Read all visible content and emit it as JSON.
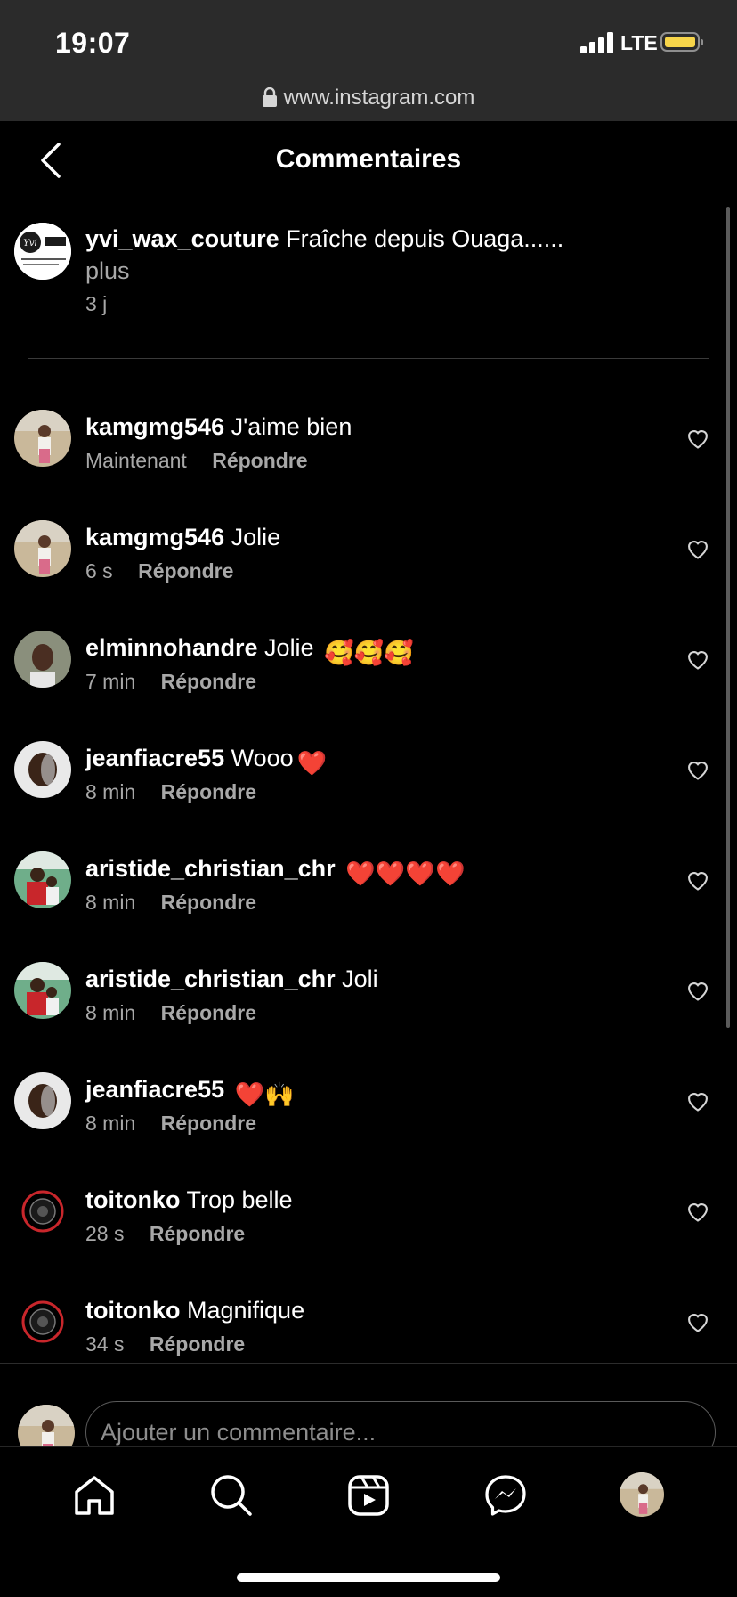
{
  "status": {
    "time": "19:07",
    "network": "LTE"
  },
  "browser": {
    "url": "www.instagram.com"
  },
  "header": {
    "title": "Commentaires"
  },
  "caption": {
    "username": "yvi_wax_couture",
    "text": "Fraîche depuis Ouaga......",
    "more": "plus",
    "time": "3 j"
  },
  "comments": [
    {
      "username": "kamgmg546",
      "text": "J'aime bien",
      "time": "Maintenant",
      "reply": "Répondre"
    },
    {
      "username": "kamgmg546",
      "text": "Jolie",
      "time": "6 s",
      "reply": "Répondre"
    },
    {
      "username": "elminnohandre",
      "text": "Jolie",
      "emoji": "🥰🥰🥰",
      "time": "7 min",
      "reply": "Répondre"
    },
    {
      "username": "jeanfiacre55",
      "text": "Wooo",
      "emoji": "❤️",
      "time": "8 min",
      "reply": "Répondre"
    },
    {
      "username": "aristide_christian_chr",
      "text": "",
      "emoji": "❤️❤️❤️❤️",
      "time": "8 min",
      "reply": "Répondre"
    },
    {
      "username": "aristide_christian_chr",
      "text": "Joli",
      "time": "8 min",
      "reply": "Répondre"
    },
    {
      "username": "jeanfiacre55",
      "text": "",
      "emoji": "❤️🙌",
      "time": "8 min",
      "reply": "Répondre"
    },
    {
      "username": "toitonko",
      "text": "Trop belle",
      "time": "28 s",
      "reply": "Répondre"
    },
    {
      "username": "toitonko",
      "text": "Magnifique",
      "time": "34 s",
      "reply": "Répondre"
    }
  ],
  "composer": {
    "placeholder": "Ajouter un commentaire..."
  },
  "tabs": [
    "home-icon",
    "search-icon",
    "reels-icon",
    "messenger-icon",
    "profile-icon"
  ],
  "colors": {
    "background": "#000000",
    "muted_text": "#a8a8a8",
    "battery": "#f7d54a",
    "status_bar": "#2b2b2b"
  }
}
